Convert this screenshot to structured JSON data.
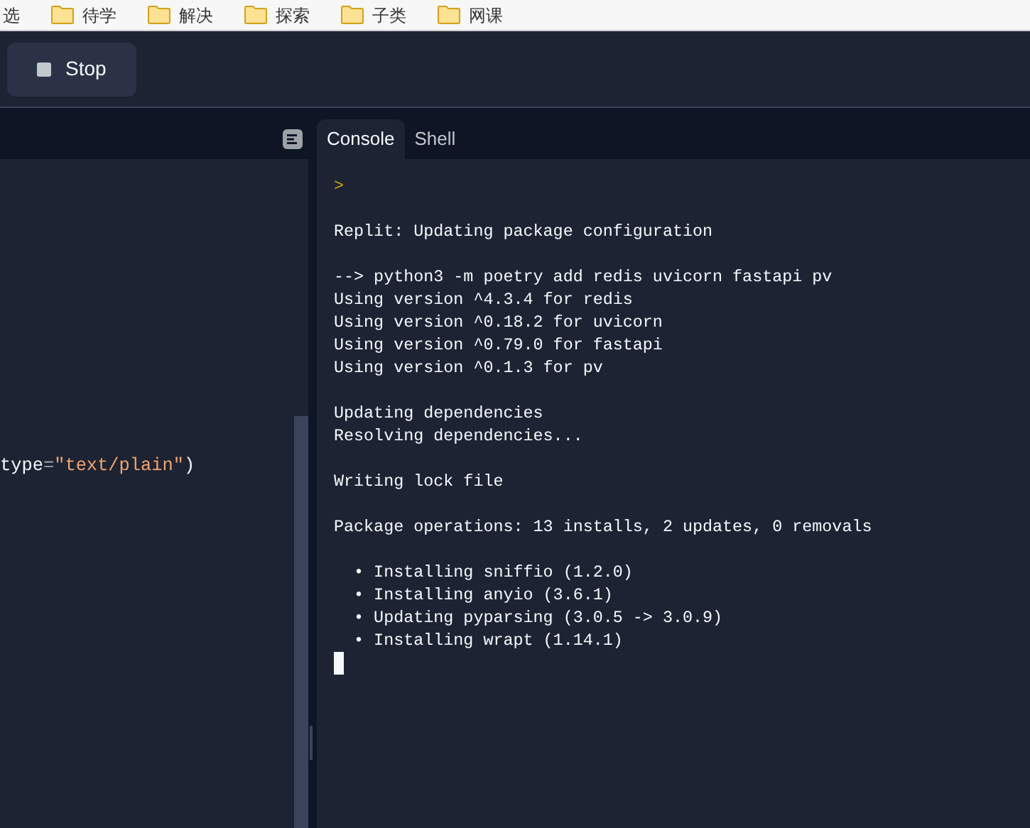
{
  "bookmarks_bar": {
    "items": [
      {
        "label": "选",
        "kind": "text"
      },
      {
        "label": "待学",
        "kind": "folder"
      },
      {
        "label": "解决",
        "kind": "folder"
      },
      {
        "label": "探索",
        "kind": "folder"
      },
      {
        "label": "子类",
        "kind": "folder"
      },
      {
        "label": "网课",
        "kind": "folder"
      }
    ]
  },
  "toolbar": {
    "stop_button": {
      "label": "Stop"
    }
  },
  "editor": {
    "lines": [
      {
        "tokens": [
          {
            "kind": "plain",
            "text": "type"
          },
          {
            "kind": "operator",
            "text": "="
          },
          {
            "kind": "string",
            "text": "\"text/plain\""
          },
          {
            "kind": "plain",
            "text": ")"
          }
        ]
      }
    ]
  },
  "tabs": [
    {
      "label": "Console",
      "selected": true
    },
    {
      "label": "Shell",
      "selected": false
    }
  ],
  "console": {
    "lines": [
      {
        "kind": "prompt",
        "text": ">"
      },
      {
        "kind": "blank"
      },
      {
        "kind": "output",
        "text": "Replit: Updating package configuration"
      },
      {
        "kind": "blank"
      },
      {
        "kind": "output",
        "text": "--> python3 -m poetry add redis uvicorn fastapi pv"
      },
      {
        "kind": "output",
        "text": "Using version ^4.3.4 for redis"
      },
      {
        "kind": "output",
        "text": "Using version ^0.18.2 for uvicorn"
      },
      {
        "kind": "output",
        "text": "Using version ^0.79.0 for fastapi"
      },
      {
        "kind": "output",
        "text": "Using version ^0.1.3 for pv"
      },
      {
        "kind": "blank"
      },
      {
        "kind": "output",
        "text": "Updating dependencies"
      },
      {
        "kind": "output",
        "text": "Resolving dependencies..."
      },
      {
        "kind": "blank"
      },
      {
        "kind": "output",
        "text": "Writing lock file"
      },
      {
        "kind": "blank"
      },
      {
        "kind": "output",
        "text": "Package operations: 13 installs, 2 updates, 0 removals"
      },
      {
        "kind": "blank"
      },
      {
        "kind": "output",
        "text": "  • Installing sniffio (1.2.0)"
      },
      {
        "kind": "output",
        "text": "  • Installing anyio (3.6.1)"
      },
      {
        "kind": "output",
        "text": "  • Updating pyparsing (3.0.5 -> 3.0.9)"
      },
      {
        "kind": "output",
        "text": "  • Installing wrapt (1.14.1)"
      },
      {
        "kind": "cursor"
      }
    ]
  }
}
